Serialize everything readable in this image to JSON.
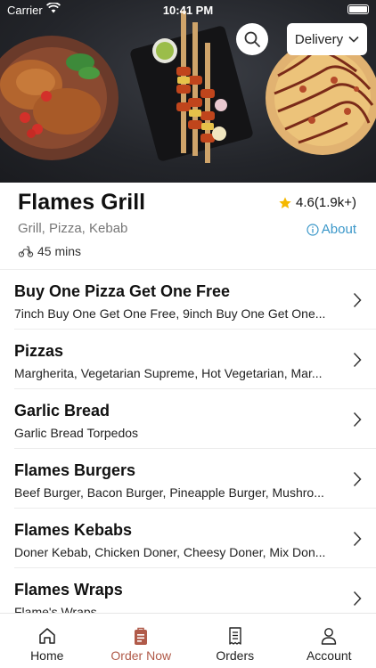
{
  "status_bar": {
    "carrier": "Carrier",
    "time": "10:41 PM"
  },
  "header": {
    "delivery_label": "Delivery"
  },
  "restaurant": {
    "name": "Flames Grill",
    "rating": "4.6(1.9k+)",
    "cuisines": "Grill, Pizza, Kebab",
    "about_label": "About",
    "delivery_time": "45 mins"
  },
  "categories": [
    {
      "title": "Buy One Pizza Get One Free",
      "desc": "7inch Buy One Get One Free, 9inch Buy One Get One..."
    },
    {
      "title": "Pizzas",
      "desc": "Margherita, Vegetarian Supreme, Hot Vegetarian, Mar..."
    },
    {
      "title": "Garlic Bread",
      "desc": "Garlic Bread Torpedos"
    },
    {
      "title": "Flames Burgers",
      "desc": "Beef Burger, Bacon Burger, Pineapple Burger, Mushro..."
    },
    {
      "title": "Flames Kebabs",
      "desc": "Doner Kebab, Chicken Doner, Cheesy Doner, Mix Don..."
    },
    {
      "title": "Flames Wraps",
      "desc": "Flame's Wraps"
    }
  ],
  "tabs": [
    {
      "label": "Home",
      "icon": "home-icon"
    },
    {
      "label": "Order Now",
      "icon": "order-bag-icon",
      "active": true
    },
    {
      "label": "Orders",
      "icon": "receipt-icon"
    },
    {
      "label": "Account",
      "icon": "person-icon"
    }
  ],
  "colors": {
    "accent": "#b05a49",
    "link": "#3a97c9",
    "star": "#f5b800"
  }
}
